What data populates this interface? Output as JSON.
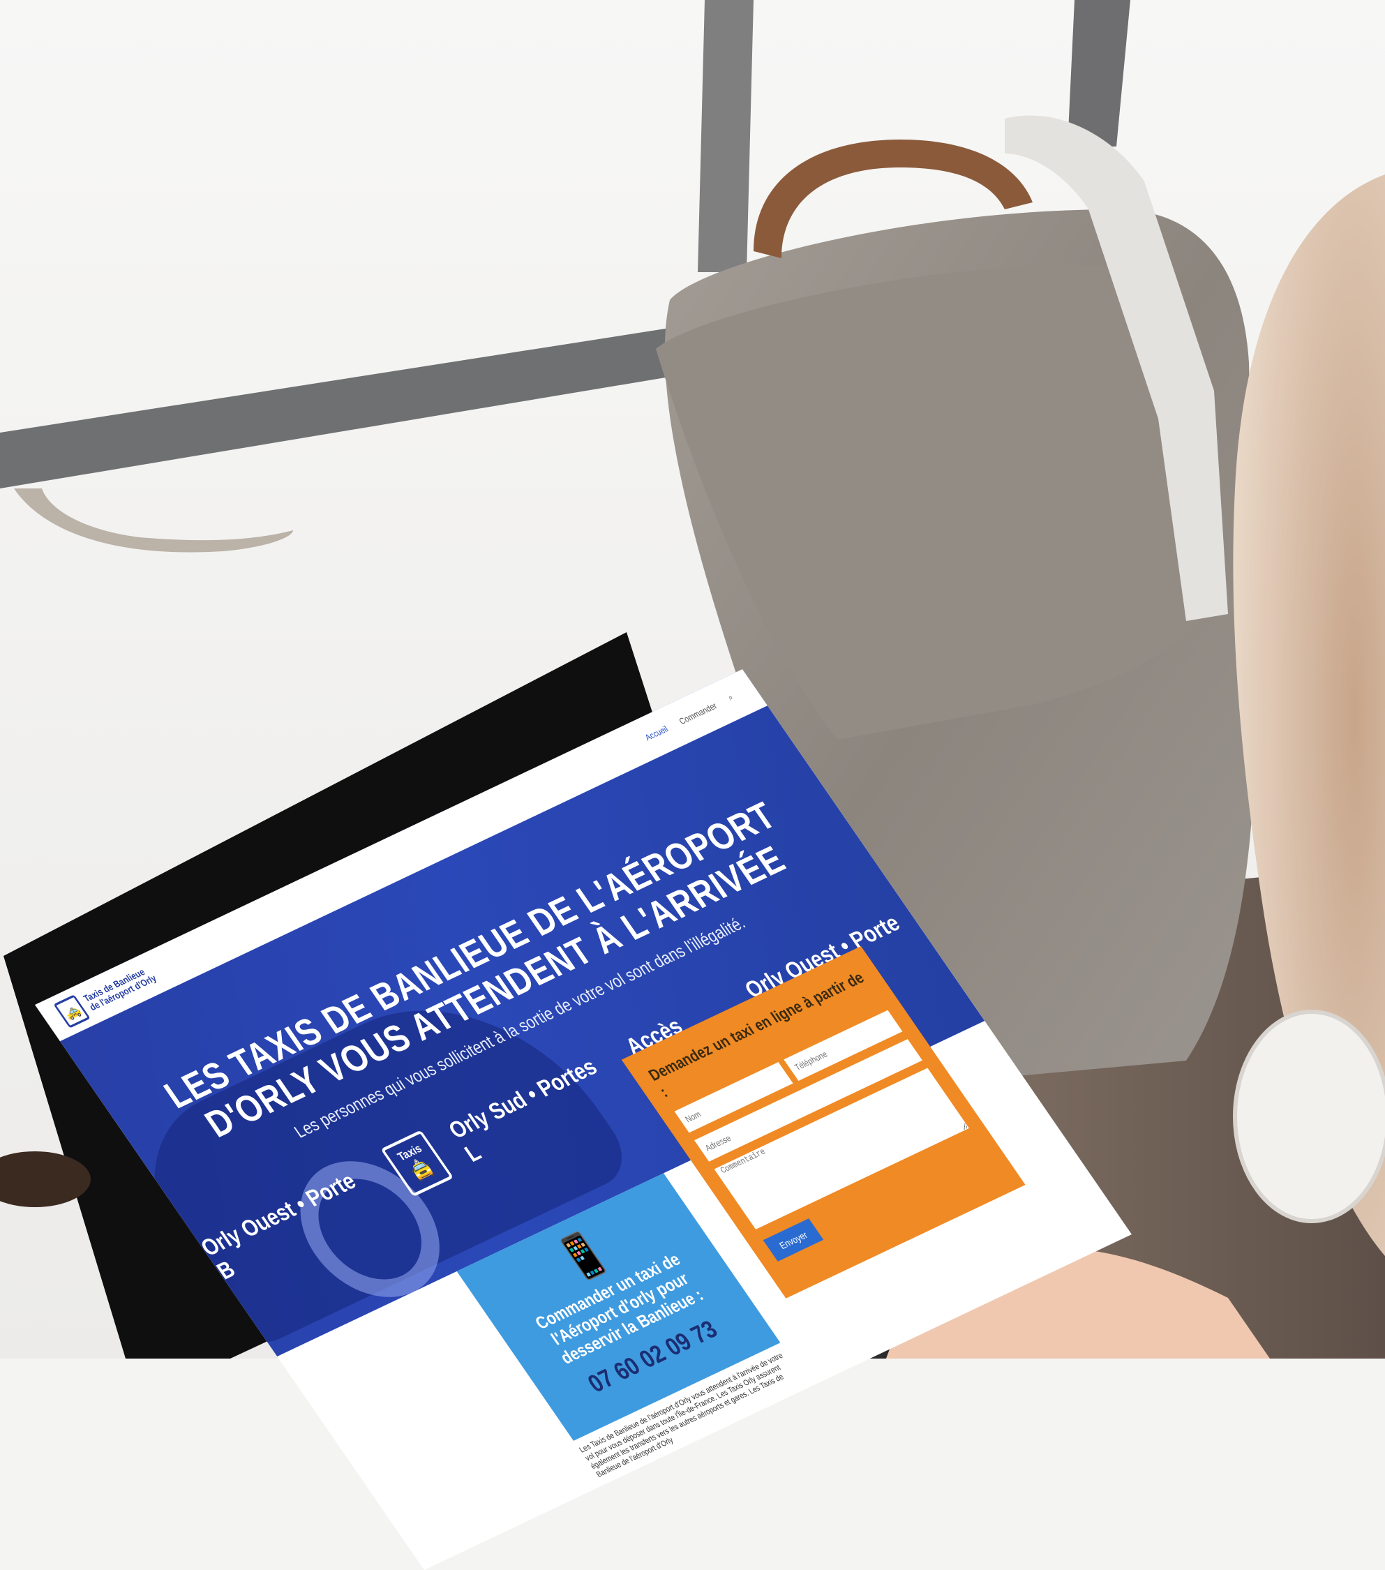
{
  "colors": {
    "brand_blue": "#2a48b8",
    "card_blue": "#3f9be0",
    "form_orange": "#f08a24",
    "submit_blue": "#2a6bd1"
  },
  "site": {
    "logo_line1": "Taxis de Banlieue",
    "logo_line2": "de l'aéroport d'Orly",
    "nav": [
      "Accueil",
      "Commander",
      "search-icon"
    ],
    "hero_title_line1": "LES TAXIS DE BANLIEUE DE L'AÉROPORT",
    "hero_title_line2": "D'ORLY VOUS ATTENDENT À L'ARRIVÉE",
    "hero_subtitle": "Les personnes qui vous sollicitent à la sortie de votre vol sont dans l'illégalité.",
    "badges": [
      "Orly Ouest • Porte B",
      "Orly Sud • Portes L",
      "Accès Taxis",
      "Orly Ouest • Porte B"
    ],
    "taxi_sign": "Taxis",
    "card_cta": "Commander un taxi de l'Aéroport d'orly pour desservir la Banlieue :",
    "card_phone": "07 60 02 09 73",
    "paragraph": "Les Taxis de Banlieue de l'aéroport d'Orly vous attendent à l'arrivée de votre vol pour vous déposer dans toute l'Île-de-France. Les Taxis Orly assurent également les transferts vers les autres aéroports et gares. Les Taxis de Banlieue de l'aéroport d'Orly",
    "form": {
      "title": "Demandez un taxi en ligne à partir de :",
      "placeholders": [
        "Nom",
        "Téléphone",
        "Adresse",
        "Commentaire"
      ],
      "submit": "Envoyer"
    }
  }
}
